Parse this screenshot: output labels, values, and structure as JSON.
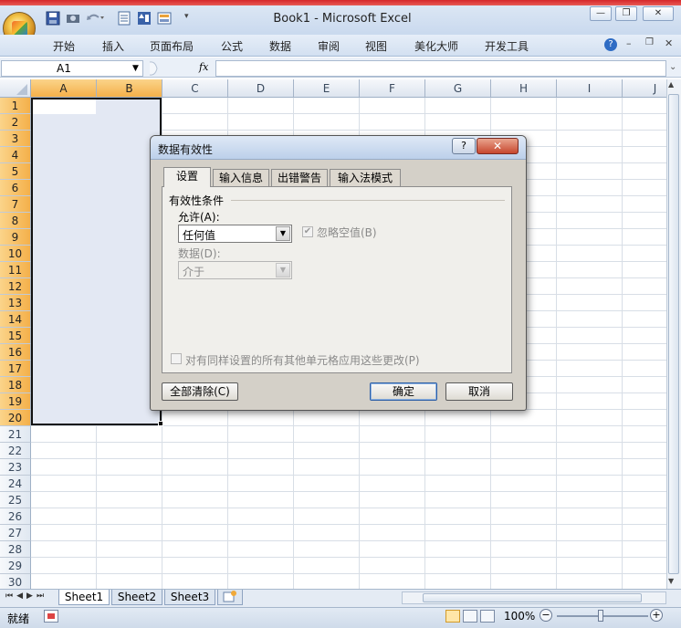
{
  "window": {
    "title": "Book1 - Microsoft Excel"
  },
  "ribbon_tabs": [
    "开始",
    "插入",
    "页面布局",
    "公式",
    "数据",
    "审阅",
    "视图",
    "美化大师",
    "开发工具"
  ],
  "formula_bar": {
    "name_box": "A1",
    "fx": "fx",
    "formula": ""
  },
  "columns": [
    "A",
    "B",
    "C",
    "D",
    "E",
    "F",
    "G",
    "H",
    "I",
    "J"
  ],
  "rows": [
    "1",
    "2",
    "3",
    "4",
    "5",
    "6",
    "7",
    "8",
    "9",
    "10",
    "11",
    "12",
    "13",
    "14",
    "15",
    "16",
    "17",
    "18",
    "19",
    "20",
    "21",
    "22",
    "23",
    "24",
    "25",
    "26",
    "27",
    "28",
    "29",
    "30"
  ],
  "sheets": [
    "Sheet1",
    "Sheet2",
    "Sheet3"
  ],
  "status": {
    "ready": "就绪",
    "zoom": "100%"
  },
  "dialog": {
    "title": "数据有效性",
    "help": "?",
    "close": "✕",
    "tabs": [
      "设置",
      "输入信息",
      "出错警告",
      "输入法模式"
    ],
    "group_label": "有效性条件",
    "allow_label": "允许(A):",
    "allow_value": "任何值",
    "ignore_blank_label": "忽略空值(B)",
    "data_label": "数据(D):",
    "data_value": "介于",
    "apply_all_label": "对有同样设置的所有其他单元格应用这些更改(P)",
    "clear_all_button": "全部清除(C)",
    "ok_button": "确定",
    "cancel_button": "取消"
  },
  "colors": {
    "selection_header": "#f4b04a",
    "selection_fill": "#e3e8f3",
    "title_red": "#d6282a"
  }
}
